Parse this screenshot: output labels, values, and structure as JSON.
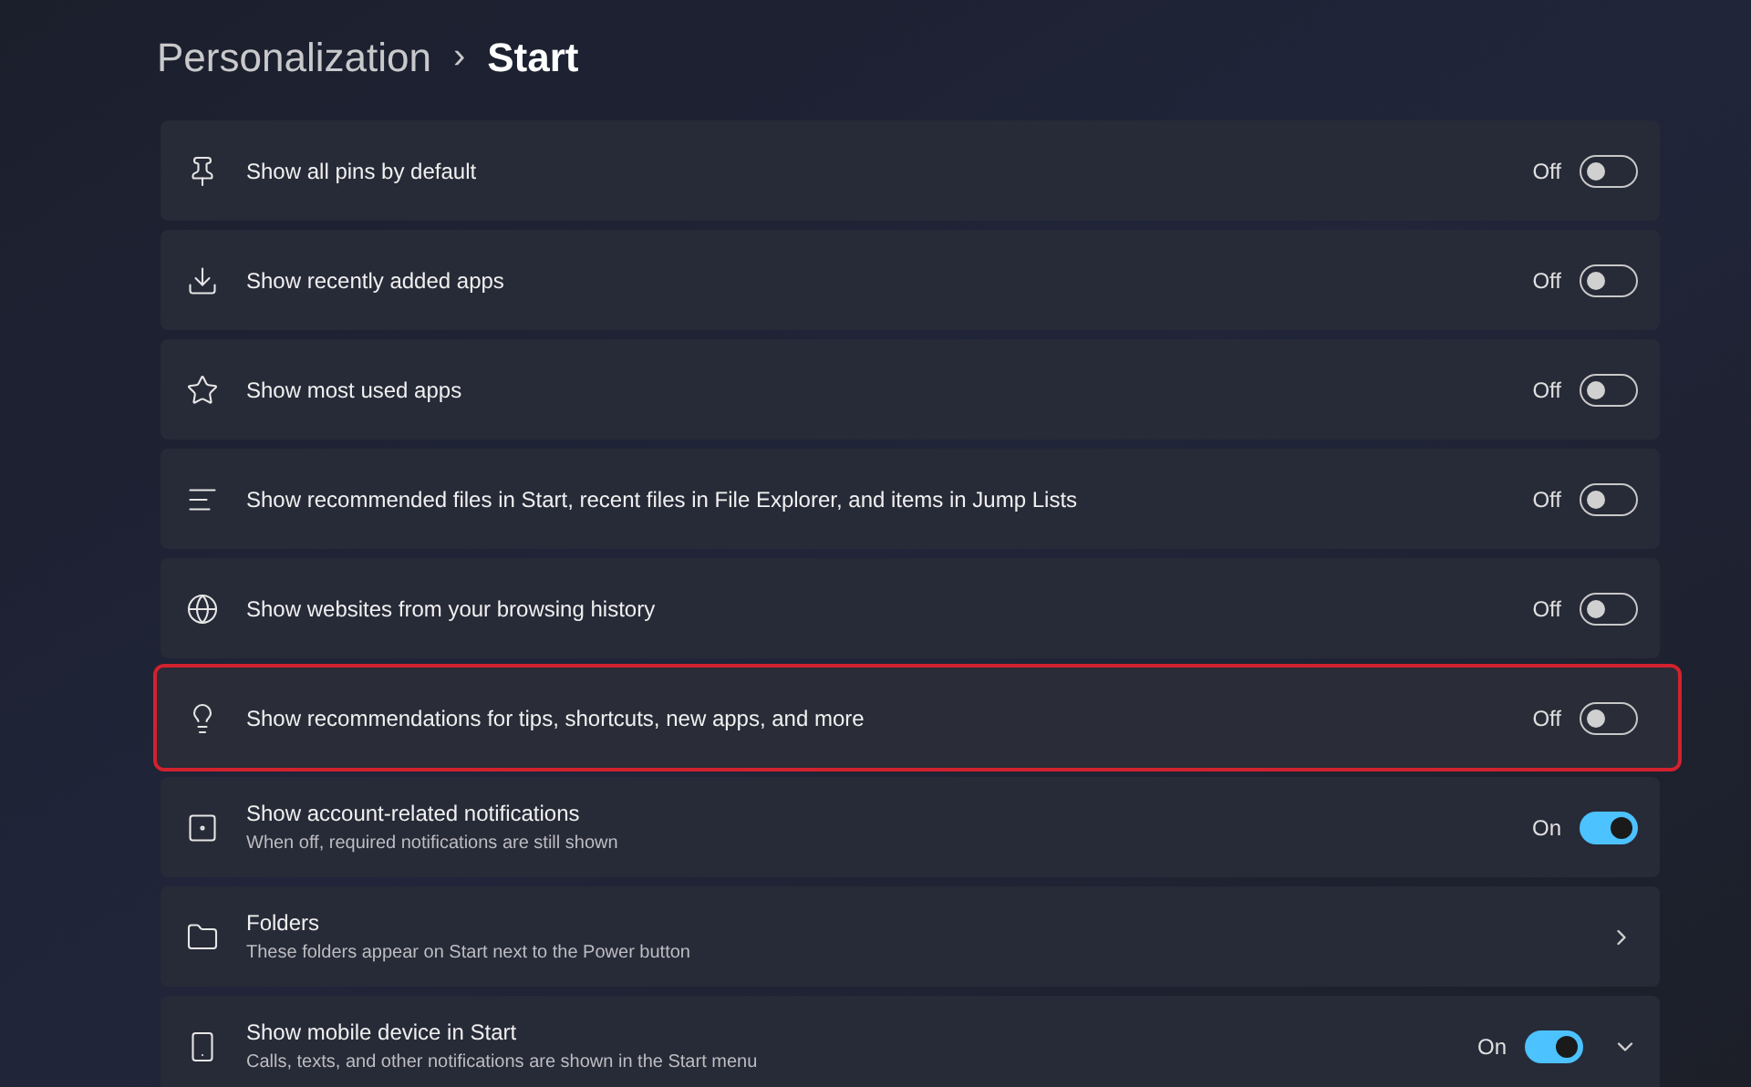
{
  "breadcrumb": {
    "parent": "Personalization",
    "separator": "›",
    "current": "Start"
  },
  "settings": [
    {
      "kind": "toggle",
      "title": "Show all pins by default",
      "state_label": "Off",
      "on": false,
      "highlighted": false
    },
    {
      "kind": "toggle",
      "title": "Show recently added apps",
      "state_label": "Off",
      "on": false,
      "highlighted": false
    },
    {
      "kind": "toggle",
      "title": "Show most used apps",
      "state_label": "Off",
      "on": false,
      "highlighted": false
    },
    {
      "kind": "toggle",
      "title": "Show recommended files in Start, recent files in File Explorer, and items in Jump Lists",
      "state_label": "Off",
      "on": false,
      "highlighted": false
    },
    {
      "kind": "toggle",
      "title": "Show websites from your browsing history",
      "state_label": "Off",
      "on": false,
      "highlighted": false
    },
    {
      "kind": "toggle",
      "title": "Show recommendations for tips, shortcuts, new apps, and more",
      "state_label": "Off",
      "on": false,
      "highlighted": true
    },
    {
      "kind": "toggle",
      "title": "Show account-related notifications",
      "description": "When off, required notifications are still shown",
      "state_label": "On",
      "on": true,
      "highlighted": false
    },
    {
      "kind": "link",
      "title": "Folders",
      "description": "These folders appear on Start next to the Power button",
      "highlighted": false
    },
    {
      "kind": "expander",
      "title": "Show mobile device in Start",
      "description": "Calls, texts, and other notifications are shown in the Start menu",
      "state_label": "On",
      "on": true,
      "expanded": false,
      "highlighted": false
    }
  ]
}
